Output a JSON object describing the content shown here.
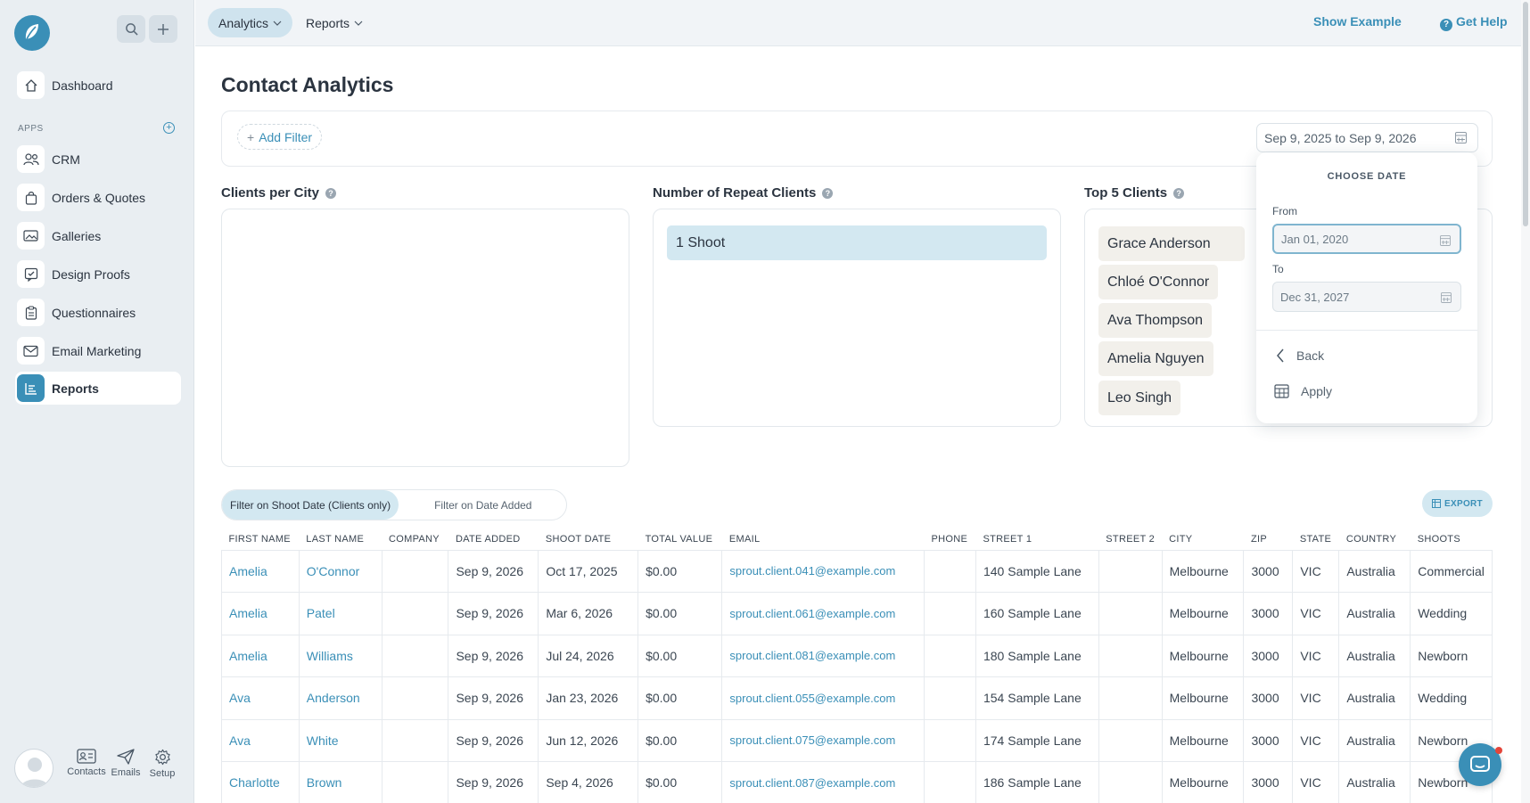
{
  "sidebar": {
    "apps_label": "APPS",
    "items": [
      {
        "label": "Dashboard",
        "icon": "home-icon"
      },
      {
        "label": "CRM",
        "icon": "users-icon"
      },
      {
        "label": "Orders & Quotes",
        "icon": "shopping-bag-icon"
      },
      {
        "label": "Galleries",
        "icon": "image-gallery-icon"
      },
      {
        "label": "Design Proofs",
        "icon": "proof-check-icon"
      },
      {
        "label": "Questionnaires",
        "icon": "clipboard-icon"
      },
      {
        "label": "Email Marketing",
        "icon": "envelope-icon"
      },
      {
        "label": "Reports",
        "icon": "report-icon",
        "active": true
      }
    ],
    "footer": [
      {
        "label": "Contacts",
        "icon": "contact-card-icon"
      },
      {
        "label": "Emails",
        "icon": "paper-plane-icon"
      },
      {
        "label": "Setup",
        "icon": "gear-icon"
      }
    ]
  },
  "topbar": {
    "menus": [
      {
        "label": "Analytics",
        "active": true
      },
      {
        "label": "Reports",
        "active": false
      }
    ],
    "show_example": "Show Example",
    "get_help": "Get Help"
  },
  "page": {
    "title": "Contact Analytics",
    "add_filter": "Add Filter",
    "date_range": "Sep 9, 2025 to Sep 9, 2026"
  },
  "cards": {
    "clients_per_city": {
      "title": "Clients per City"
    },
    "repeat_clients": {
      "title": "Number of Repeat Clients",
      "items": [
        "1 Shoot"
      ]
    },
    "top_clients": {
      "title": "Top 5 Clients",
      "items": [
        "Grace Anderson",
        "Chloé O'Connor",
        "Ava Thompson",
        "Amelia Nguyen",
        "Leo Singh"
      ]
    }
  },
  "date_popup": {
    "title": "CHOOSE DATE",
    "from_label": "From",
    "from_value": "Jan 01, 2020",
    "to_label": "To",
    "to_value": "Dec 31, 2027",
    "back": "Back",
    "apply": "Apply"
  },
  "toggle": {
    "option_shoot": "Filter on Shoot Date (Clients only)",
    "option_added": "Filter on Date Added",
    "selected": "Filter on Shoot Date (Clients only)"
  },
  "export_label": "EXPORT",
  "table": {
    "columns": [
      "FIRST NAME",
      "LAST NAME",
      "COMPANY",
      "DATE ADDED",
      "SHOOT DATE",
      "TOTAL VALUE",
      "EMAIL",
      "PHONE",
      "STREET 1",
      "STREET 2",
      "CITY",
      "ZIP",
      "STATE",
      "COUNTRY",
      "SHOOTS"
    ],
    "rows": [
      [
        "Amelia",
        "O'Connor",
        "",
        "Sep 9, 2026",
        "Oct 17, 2025",
        "$0.00",
        "sprout.client.041@example.com",
        "",
        "140 Sample Lane",
        "",
        "Melbourne",
        "3000",
        "VIC",
        "Australia",
        "Commercial"
      ],
      [
        "Amelia",
        "Patel",
        "",
        "Sep 9, 2026",
        "Mar 6, 2026",
        "$0.00",
        "sprout.client.061@example.com",
        "",
        "160 Sample Lane",
        "",
        "Melbourne",
        "3000",
        "VIC",
        "Australia",
        "Wedding"
      ],
      [
        "Amelia",
        "Williams",
        "",
        "Sep 9, 2026",
        "Jul 24, 2026",
        "$0.00",
        "sprout.client.081@example.com",
        "",
        "180 Sample Lane",
        "",
        "Melbourne",
        "3000",
        "VIC",
        "Australia",
        "Newborn"
      ],
      [
        "Ava",
        "Anderson",
        "",
        "Sep 9, 2026",
        "Jan 23, 2026",
        "$0.00",
        "sprout.client.055@example.com",
        "",
        "154 Sample Lane",
        "",
        "Melbourne",
        "3000",
        "VIC",
        "Australia",
        "Wedding"
      ],
      [
        "Ava",
        "White",
        "",
        "Sep 9, 2026",
        "Jun 12, 2026",
        "$0.00",
        "sprout.client.075@example.com",
        "",
        "174 Sample Lane",
        "",
        "Melbourne",
        "3000",
        "VIC",
        "Australia",
        "Newborn"
      ],
      [
        "Charlotte",
        "Brown",
        "",
        "Sep 9, 2026",
        "Sep 4, 2026",
        "$0.00",
        "sprout.client.087@example.com",
        "",
        "186 Sample Lane",
        "",
        "Melbourne",
        "3000",
        "VIC",
        "Australia",
        "Newborn"
      ]
    ]
  },
  "colors": {
    "accent": "#3a8fb7",
    "sidebar_bg": "#e9eef2",
    "highlight": "#d3e8f1"
  }
}
